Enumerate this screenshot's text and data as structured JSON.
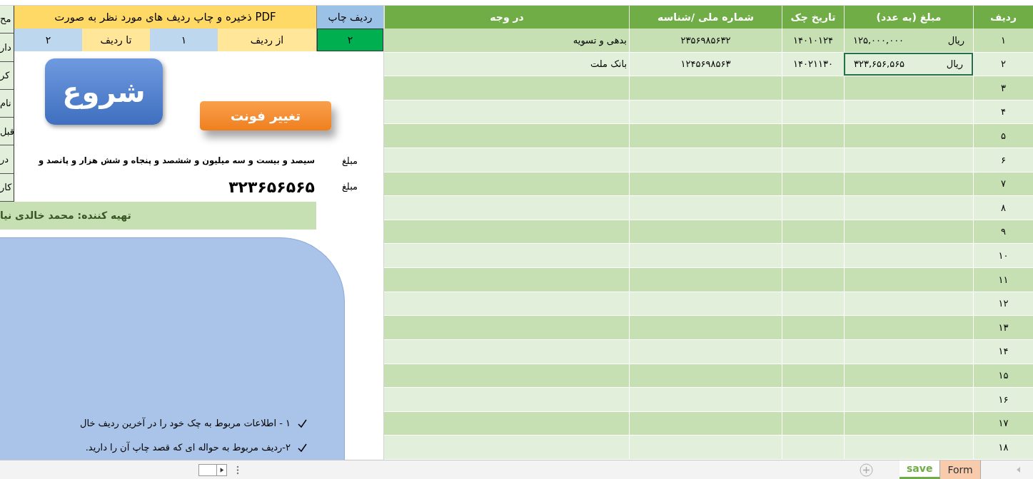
{
  "print_panel": {
    "title": "ذخیره و چاپ ردیف های مورد نظر به صورت PDF",
    "print_row_label": "ردیف چاپ",
    "print_row_value": "۲",
    "from_label": "از ردیف",
    "from_value": "۱",
    "to_label": "تا ردیف",
    "to_value": "۲"
  },
  "side_labels": [
    "مح",
    "دار",
    "کر",
    "نام",
    "قبل",
    "در",
    "کار"
  ],
  "buttons": [
    {
      "kind": "start",
      "label": "شروع"
    },
    {
      "kind": "font",
      "label": "تغییر فونت"
    }
  ],
  "amount_lines": [
    {
      "kind": "words",
      "label": "مبلغ",
      "value": "سیصد و بیست و سه میلیون و ششصد و پنجاه و شش هزار و پانصد و"
    },
    {
      "kind": "digits",
      "label": "مبلغ",
      "value": "۳۲۳۶۵۶۵۶۵"
    }
  ],
  "author": "تهیه کننده: محمد خالدی نیا",
  "instructions": [
    "۱ - اطلاعات مربوط به چک خود را در آخرین ردیف خال",
    "۲-ردیف مربوط به حواله ای که قصد چاپ آن را دارید."
  ],
  "table": {
    "columns": [
      "ردیف",
      "مبلغ (به عدد)",
      "تاریخ چک",
      "شماره ملی /شناسه",
      "در وجه"
    ],
    "rows": [
      {
        "index": "۱",
        "currency": "ریال",
        "amount": "۱۲۵,۰۰۰,۰۰۰",
        "date": "۱۴۰۱۰۱۲۴",
        "id": "۲۳۵۶۹۸۵۶۳۲",
        "payee": "بدهی و تسویه",
        "selected": false
      },
      {
        "index": "۲",
        "currency": "ریال",
        "amount": "۳۲۳,۶۵۶,۵۶۵",
        "date": "۱۴۰۲۱۱۳۰",
        "id": "۱۲۴۵۶۹۸۵۶۳",
        "payee": "بانک ملت",
        "selected": true
      },
      {
        "index": "۳"
      },
      {
        "index": "۴"
      },
      {
        "index": "۵"
      },
      {
        "index": "۶"
      },
      {
        "index": "۷"
      },
      {
        "index": "۸"
      },
      {
        "index": "۹"
      },
      {
        "index": "۱۰"
      },
      {
        "index": "۱۱"
      },
      {
        "index": "۱۲"
      },
      {
        "index": "۱۳"
      },
      {
        "index": "۱۴"
      },
      {
        "index": "۱۵"
      },
      {
        "index": "۱۶"
      },
      {
        "index": "۱۷"
      },
      {
        "index": "۱۸"
      }
    ]
  },
  "sheet_tabs": [
    {
      "label": "Form",
      "selected": false,
      "color": "#f8cbad"
    },
    {
      "label": "save",
      "selected": true,
      "color": "#70ad47"
    }
  ]
}
